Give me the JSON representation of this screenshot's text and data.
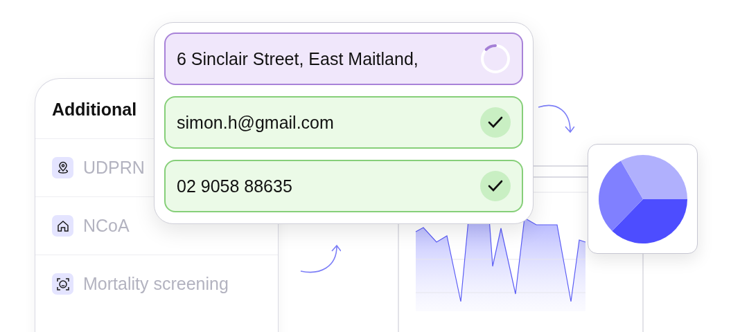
{
  "services_card": {
    "title": "Additional",
    "items": [
      {
        "label": "UDPRN"
      },
      {
        "label": "NCoA"
      },
      {
        "label": "Mortality screening"
      }
    ]
  },
  "validation_card": {
    "fields": [
      {
        "value": "6 Sinclair Street, East Maitland,",
        "verified": false
      },
      {
        "value": "simon.h@gmail.com",
        "verified": true
      },
      {
        "value": "02 9058 88635",
        "verified": true
      }
    ]
  }
}
